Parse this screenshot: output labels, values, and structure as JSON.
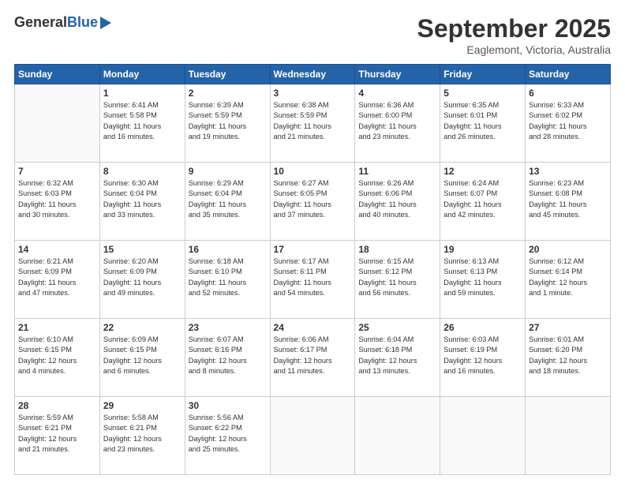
{
  "header": {
    "logo_general": "General",
    "logo_blue": "Blue",
    "title": "September 2025",
    "location": "Eaglemont, Victoria, Australia"
  },
  "columns": [
    "Sunday",
    "Monday",
    "Tuesday",
    "Wednesday",
    "Thursday",
    "Friday",
    "Saturday"
  ],
  "weeks": [
    [
      {
        "day": "",
        "info": ""
      },
      {
        "day": "1",
        "info": "Sunrise: 6:41 AM\nSunset: 5:58 PM\nDaylight: 11 hours\nand 16 minutes."
      },
      {
        "day": "2",
        "info": "Sunrise: 6:39 AM\nSunset: 5:59 PM\nDaylight: 11 hours\nand 19 minutes."
      },
      {
        "day": "3",
        "info": "Sunrise: 6:38 AM\nSunset: 5:59 PM\nDaylight: 11 hours\nand 21 minutes."
      },
      {
        "day": "4",
        "info": "Sunrise: 6:36 AM\nSunset: 6:00 PM\nDaylight: 11 hours\nand 23 minutes."
      },
      {
        "day": "5",
        "info": "Sunrise: 6:35 AM\nSunset: 6:01 PM\nDaylight: 11 hours\nand 26 minutes."
      },
      {
        "day": "6",
        "info": "Sunrise: 6:33 AM\nSunset: 6:02 PM\nDaylight: 11 hours\nand 28 minutes."
      }
    ],
    [
      {
        "day": "7",
        "info": "Sunrise: 6:32 AM\nSunset: 6:03 PM\nDaylight: 11 hours\nand 30 minutes."
      },
      {
        "day": "8",
        "info": "Sunrise: 6:30 AM\nSunset: 6:04 PM\nDaylight: 11 hours\nand 33 minutes."
      },
      {
        "day": "9",
        "info": "Sunrise: 6:29 AM\nSunset: 6:04 PM\nDaylight: 11 hours\nand 35 minutes."
      },
      {
        "day": "10",
        "info": "Sunrise: 6:27 AM\nSunset: 6:05 PM\nDaylight: 11 hours\nand 37 minutes."
      },
      {
        "day": "11",
        "info": "Sunrise: 6:26 AM\nSunset: 6:06 PM\nDaylight: 11 hours\nand 40 minutes."
      },
      {
        "day": "12",
        "info": "Sunrise: 6:24 AM\nSunset: 6:07 PM\nDaylight: 11 hours\nand 42 minutes."
      },
      {
        "day": "13",
        "info": "Sunrise: 6:23 AM\nSunset: 6:08 PM\nDaylight: 11 hours\nand 45 minutes."
      }
    ],
    [
      {
        "day": "14",
        "info": "Sunrise: 6:21 AM\nSunset: 6:09 PM\nDaylight: 11 hours\nand 47 minutes."
      },
      {
        "day": "15",
        "info": "Sunrise: 6:20 AM\nSunset: 6:09 PM\nDaylight: 11 hours\nand 49 minutes."
      },
      {
        "day": "16",
        "info": "Sunrise: 6:18 AM\nSunset: 6:10 PM\nDaylight: 11 hours\nand 52 minutes."
      },
      {
        "day": "17",
        "info": "Sunrise: 6:17 AM\nSunset: 6:11 PM\nDaylight: 11 hours\nand 54 minutes."
      },
      {
        "day": "18",
        "info": "Sunrise: 6:15 AM\nSunset: 6:12 PM\nDaylight: 11 hours\nand 56 minutes."
      },
      {
        "day": "19",
        "info": "Sunrise: 6:13 AM\nSunset: 6:13 PM\nDaylight: 11 hours\nand 59 minutes."
      },
      {
        "day": "20",
        "info": "Sunrise: 6:12 AM\nSunset: 6:14 PM\nDaylight: 12 hours\nand 1 minute."
      }
    ],
    [
      {
        "day": "21",
        "info": "Sunrise: 6:10 AM\nSunset: 6:15 PM\nDaylight: 12 hours\nand 4 minutes."
      },
      {
        "day": "22",
        "info": "Sunrise: 6:09 AM\nSunset: 6:15 PM\nDaylight: 12 hours\nand 6 minutes."
      },
      {
        "day": "23",
        "info": "Sunrise: 6:07 AM\nSunset: 6:16 PM\nDaylight: 12 hours\nand 8 minutes."
      },
      {
        "day": "24",
        "info": "Sunrise: 6:06 AM\nSunset: 6:17 PM\nDaylight: 12 hours\nand 11 minutes."
      },
      {
        "day": "25",
        "info": "Sunrise: 6:04 AM\nSunset: 6:18 PM\nDaylight: 12 hours\nand 13 minutes."
      },
      {
        "day": "26",
        "info": "Sunrise: 6:03 AM\nSunset: 6:19 PM\nDaylight: 12 hours\nand 16 minutes."
      },
      {
        "day": "27",
        "info": "Sunrise: 6:01 AM\nSunset: 6:20 PM\nDaylight: 12 hours\nand 18 minutes."
      }
    ],
    [
      {
        "day": "28",
        "info": "Sunrise: 5:59 AM\nSunset: 6:21 PM\nDaylight: 12 hours\nand 21 minutes."
      },
      {
        "day": "29",
        "info": "Sunrise: 5:58 AM\nSunset: 6:21 PM\nDaylight: 12 hours\nand 23 minutes."
      },
      {
        "day": "30",
        "info": "Sunrise: 5:56 AM\nSunset: 6:22 PM\nDaylight: 12 hours\nand 25 minutes."
      },
      {
        "day": "",
        "info": ""
      },
      {
        "day": "",
        "info": ""
      },
      {
        "day": "",
        "info": ""
      },
      {
        "day": "",
        "info": ""
      }
    ]
  ]
}
